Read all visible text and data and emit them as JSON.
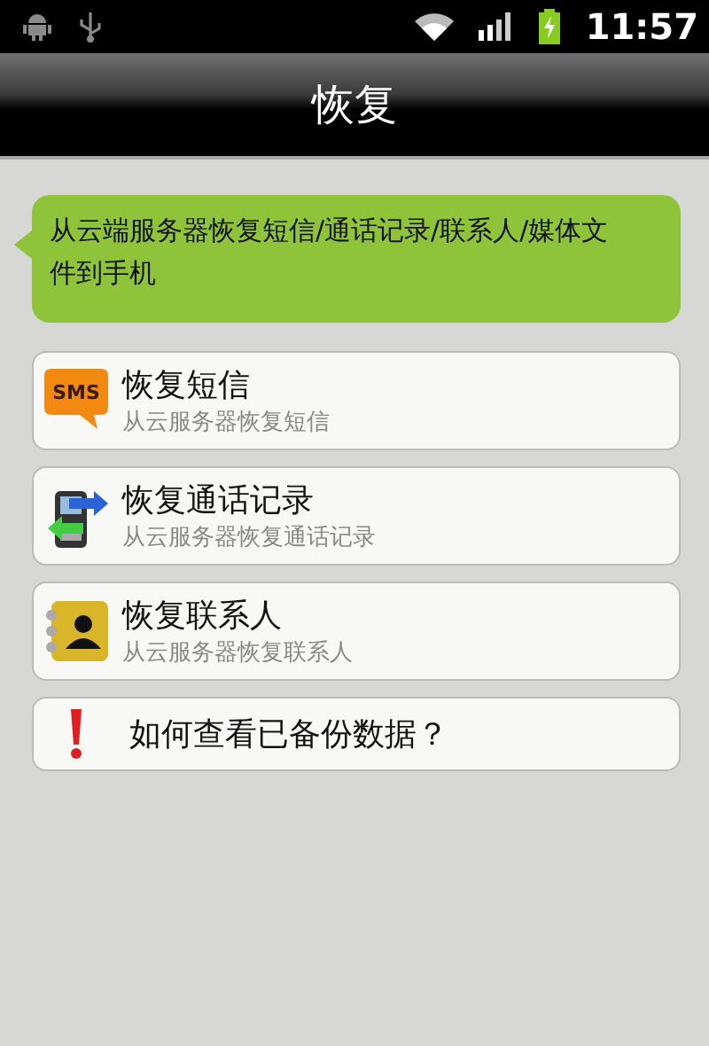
{
  "status_bar": {
    "time": "11:57"
  },
  "window": {
    "title": "恢复"
  },
  "message": "从云端服务器恢复短信/通话记录/联系人/媒体文件到手机",
  "items": [
    {
      "kind": "sms",
      "icon_label": "SMS",
      "title": "恢复短信",
      "subtitle": "从云服务器恢复短信"
    },
    {
      "kind": "calls",
      "title": "恢复通话记录",
      "subtitle": "从云服务器恢复通话记录"
    },
    {
      "kind": "contacts",
      "title": "恢复联系人",
      "subtitle": "从云服务器恢复联系人"
    },
    {
      "kind": "help",
      "title": "如何查看已备份数据？"
    }
  ]
}
